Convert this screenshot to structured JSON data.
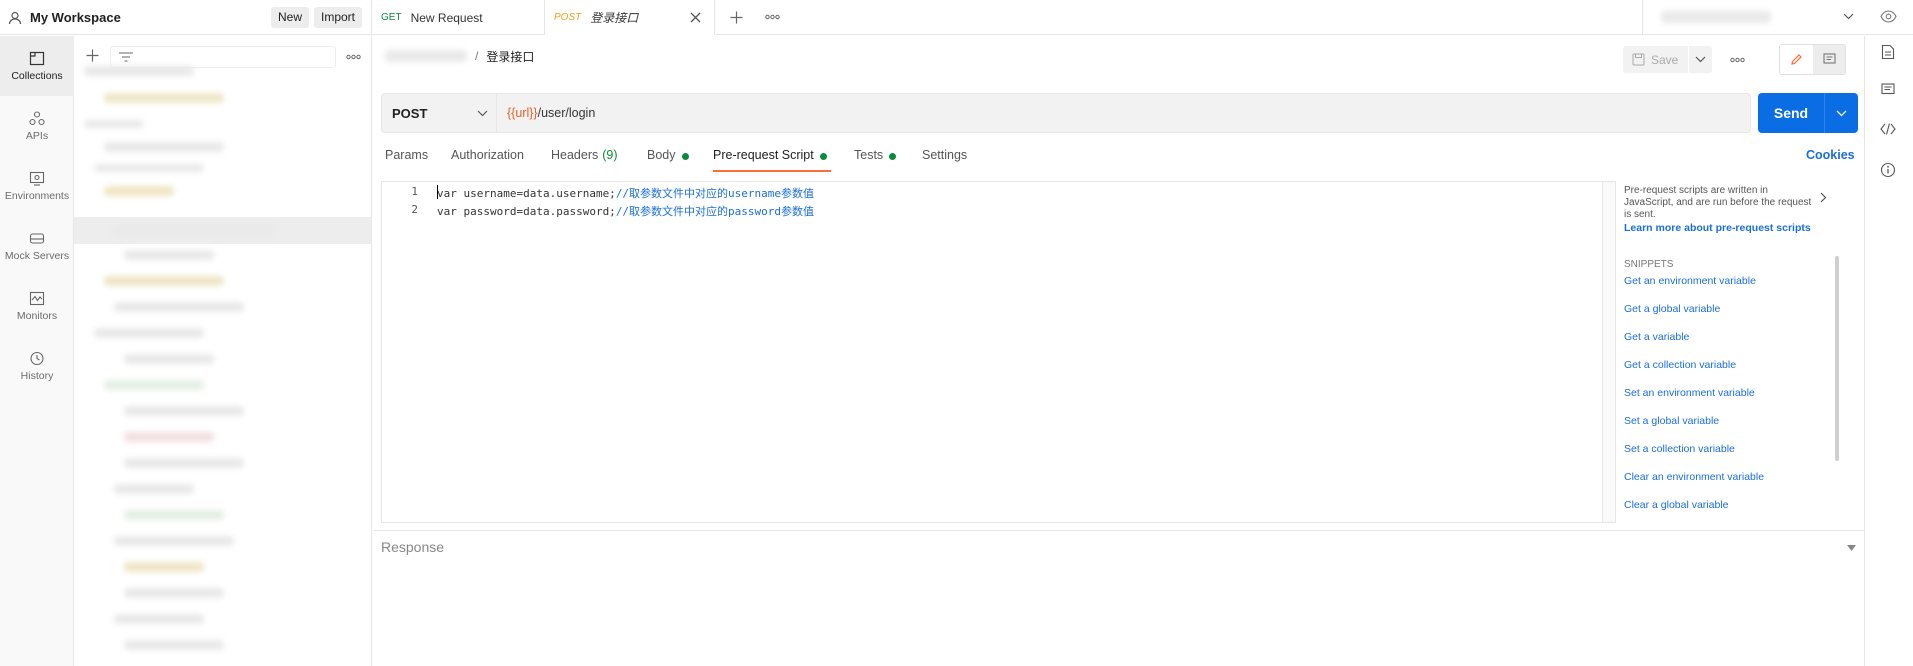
{
  "topbar": {
    "workspace_name": "My Workspace",
    "new_label": "New",
    "import_label": "Import",
    "tabs": [
      {
        "method": "GET",
        "title": "New Request",
        "method_color": "#0c8a3b"
      },
      {
        "method": "POST",
        "title": "登录接口",
        "method_color": "#f0a01e"
      }
    ]
  },
  "leftnav": {
    "items": [
      {
        "label": "Collections",
        "icon": "collections-icon"
      },
      {
        "label": "APIs",
        "icon": "apis-icon"
      },
      {
        "label": "Environments",
        "icon": "environments-icon"
      },
      {
        "label": "Mock Servers",
        "icon": "mock-servers-icon"
      },
      {
        "label": "Monitors",
        "icon": "monitors-icon"
      },
      {
        "label": "History",
        "icon": "history-icon"
      }
    ]
  },
  "request": {
    "breadcrumb_sep": "/",
    "title": "登录接口",
    "save_label": "Save",
    "method": "POST",
    "url_var": "{{url}}",
    "url_path": "/user/login",
    "send_label": "Send",
    "cookies_label": "Cookies",
    "tabs": {
      "params": "Params",
      "authorization": "Authorization",
      "headers": "Headers",
      "headers_count": "(9)",
      "body": "Body",
      "prerequest": "Pre-request Script",
      "tests": "Tests",
      "settings": "Settings"
    }
  },
  "editor": {
    "lines": [
      {
        "num": "1",
        "code": "var username=data.username;",
        "comment": "//取参数文件中对应的username参数值"
      },
      {
        "num": "2",
        "code": "var password=data.password;",
        "comment": "//取参数文件中对应的password参数值"
      }
    ]
  },
  "help": {
    "description": "Pre-request scripts are written in JavaScript, and are run before the request is sent.",
    "learn_more": "Learn more about pre-request scripts",
    "snippets_heading": "SNIPPETS",
    "snippets": [
      "Get an environment variable",
      "Get a global variable",
      "Get a variable",
      "Get a collection variable",
      "Set an environment variable",
      "Set a global variable",
      "Set a collection variable",
      "Clear an environment variable",
      "Clear a global variable"
    ]
  },
  "response": {
    "label": "Response"
  },
  "colors": {
    "accent": "#ff6c37",
    "send": "#0b6de3",
    "link": "#1a6ed8",
    "status_dot": "#0c8a3b"
  }
}
